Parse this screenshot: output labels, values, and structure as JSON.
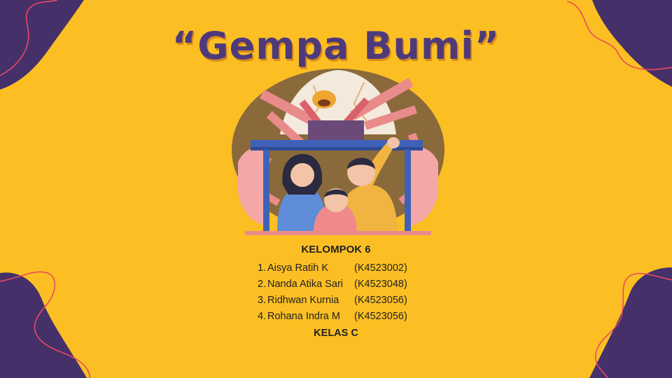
{
  "slide": {
    "title": "“Gempa Bumi”",
    "group_heading": "KELOMPOK 6",
    "members": [
      {
        "number": "1.",
        "name": "Aisya Ratih K",
        "nim": "(K4523002)"
      },
      {
        "number": "2.",
        "name": "Nanda Atika Sari",
        "nim": "(K4523048)"
      },
      {
        "number": "3.",
        "name": "Ridhwan Kurnia",
        "nim": "(K4523056)"
      },
      {
        "number": "4.",
        "name": "Rohana Indra M",
        "nim": "(K4523056)"
      }
    ],
    "class_label": "KELAS C"
  },
  "colors": {
    "background": "#fcbf23",
    "corner_blob": "#45306a",
    "corner_line": "#e84a5f",
    "title": "#4e3a7a",
    "title_shadow": "#d88a1c",
    "text": "#222222"
  }
}
